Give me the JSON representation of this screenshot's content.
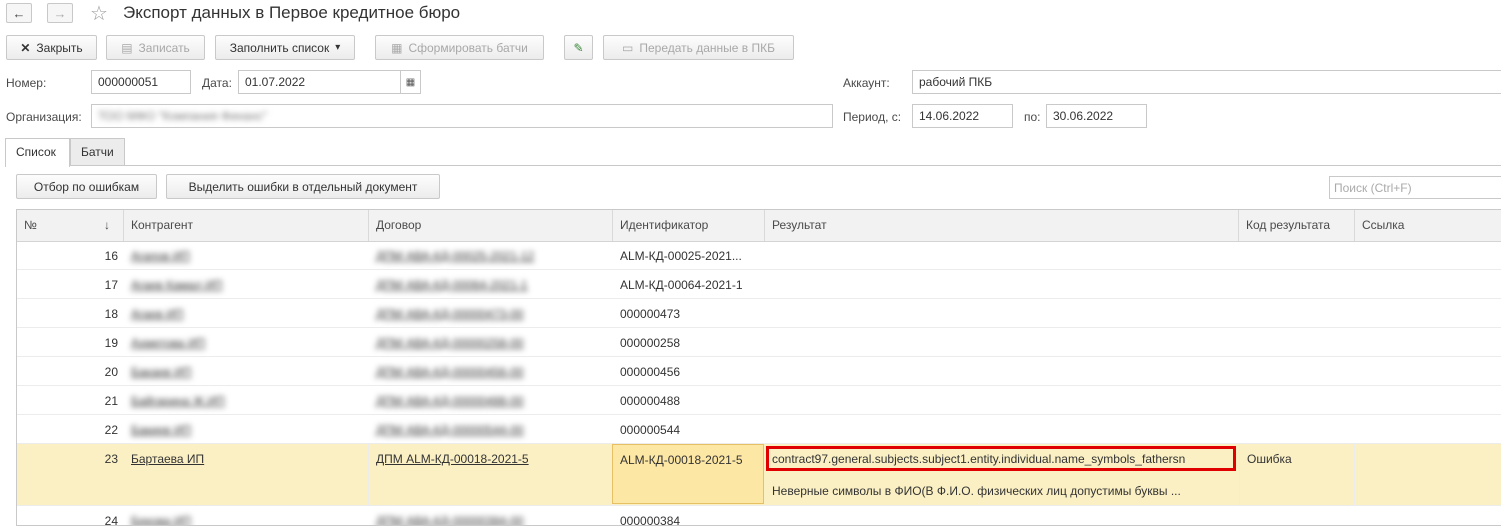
{
  "window": {
    "title": "Экспорт данных в Первое кредитное бюро",
    "back_icon": "←",
    "forward_icon": "→",
    "star_icon": "☆"
  },
  "toolbar": {
    "close_label": "Закрыть",
    "close_icon": "✕",
    "save_label": "Записать",
    "save_icon": "▤",
    "fill_label": "Заполнить список",
    "fill_arrow": "▾",
    "form_batches_label": "Сформировать батчи",
    "form_batches_icon": "▦",
    "edit_icon": "✎",
    "send_label": "Передать данные в ПКБ",
    "send_icon": "▭"
  },
  "form": {
    "number_label": "Номер:",
    "number_value": "000000051",
    "date_label": "Дата:",
    "date_value": "01.07.2022",
    "calendar_icon": "▦",
    "org_label": "Организация:",
    "org_value": "ТОО МФО \"Компания Финанс\"",
    "account_label": "Аккаунт:",
    "account_value": "рабочий ПКБ",
    "period_label": "Период, с:",
    "period_from": "14.06.2022",
    "period_to_label": "по:",
    "period_to": "30.06.2022"
  },
  "tabs": [
    {
      "label": "Список"
    },
    {
      "label": "Батчи"
    }
  ],
  "list_toolbar": {
    "filter_errors_label": "Отбор по ошибкам",
    "separate_errors_label": "Выделить ошибки в отдельный документ",
    "search_placeholder": "Поиск (Ctrl+F)"
  },
  "table": {
    "columns": [
      "№",
      "↓",
      "Контрагент",
      "Договор",
      "Идентификатор",
      "Результат",
      "Код результата",
      "Ссылка"
    ],
    "rows": [
      {
        "n": "16",
        "contractor": "Агапов ИП",
        "contract": "ДПМ АВА-КД-00025-2021-12",
        "id": "ALM-КД-00025-2021...",
        "result": "",
        "code": "",
        "link": ""
      },
      {
        "n": "17",
        "contractor": "Агаев Камал ИП",
        "contract": "ДПМ АВА-КД-00064-2021-1",
        "id": "ALM-КД-00064-2021-1",
        "result": "",
        "code": "",
        "link": ""
      },
      {
        "n": "18",
        "contractor": "Агаев ИП",
        "contract": "ДПМ АВА-КД-00000473-00",
        "id": "000000473",
        "result": "",
        "code": "",
        "link": ""
      },
      {
        "n": "19",
        "contractor": "Ахметова ИП",
        "contract": "ДПМ АВА-КД-00000258-00",
        "id": "000000258",
        "result": "",
        "code": "",
        "link": ""
      },
      {
        "n": "20",
        "contractor": "Бакаев ИП",
        "contract": "ДПМ АВА-КД-00000456-00",
        "id": "000000456",
        "result": "",
        "code": "",
        "link": ""
      },
      {
        "n": "21",
        "contractor": "Байгарина Ж.ИП",
        "contract": "ДПМ АВА-КД-00000488-00",
        "id": "000000488",
        "result": "",
        "code": "",
        "link": ""
      },
      {
        "n": "22",
        "contractor": "Бакиев ИП",
        "contract": "ДПМ АВА-КД-00000544-00",
        "id": "000000544",
        "result": "",
        "code": "",
        "link": ""
      },
      {
        "n": "23",
        "contractor": "Бартаева ИП",
        "contract": "ДПМ ALM-КД-00018-2021-5",
        "id": "ALM-КД-00018-2021-5",
        "result": "contract97.general.subjects.subject1.entity.individual.name_symbols_fathersn",
        "result2": "Неверные символы в ФИО(В Ф.И.О. физических лиц допустимы буквы ...",
        "code": "Ошибка",
        "link": ""
      },
      {
        "n": "24",
        "contractor": "Бекова ИП",
        "contract": "ДПМ АВА-КД-00000384-00",
        "id": "000000384",
        "result": "",
        "code": "",
        "link": ""
      }
    ]
  }
}
